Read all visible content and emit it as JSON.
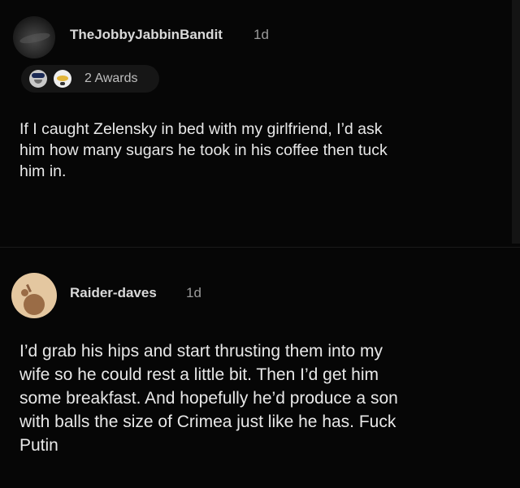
{
  "comments": [
    {
      "username": "TheJobbyJabbinBandit",
      "age": "1d",
      "awards_label": "2 Awards",
      "award_icons": [
        "police-award-icon",
        "gold-snoo-award-icon"
      ],
      "text_lines": [
        "If I caught Zelensky in bed with my girlfriend, I’d ask",
        "him how many sugars he took in his coffee then tuck",
        "him in."
      ],
      "avatar_icon": "user-avatar-icon"
    },
    {
      "username": "Raider-daves",
      "age": "1d",
      "text_lines": [
        "I’d grab his hips and start thrusting them into my",
        "wife so he could rest a little bit. Then I’d get him",
        "some breakfast. And hopefully he’d produce a son",
        "with balls the size of Crimea just like he has. Fuck",
        "Putin"
      ],
      "avatar_icon": "snoo-avatar-icon"
    }
  ],
  "colors": {
    "background": "#060606",
    "username": "#d9d9d9",
    "meta": "#9a9a9a",
    "body_text": "#e8e8e8",
    "awards_pill": "#161616",
    "avatar2_bg": "#e4c7a0"
  }
}
